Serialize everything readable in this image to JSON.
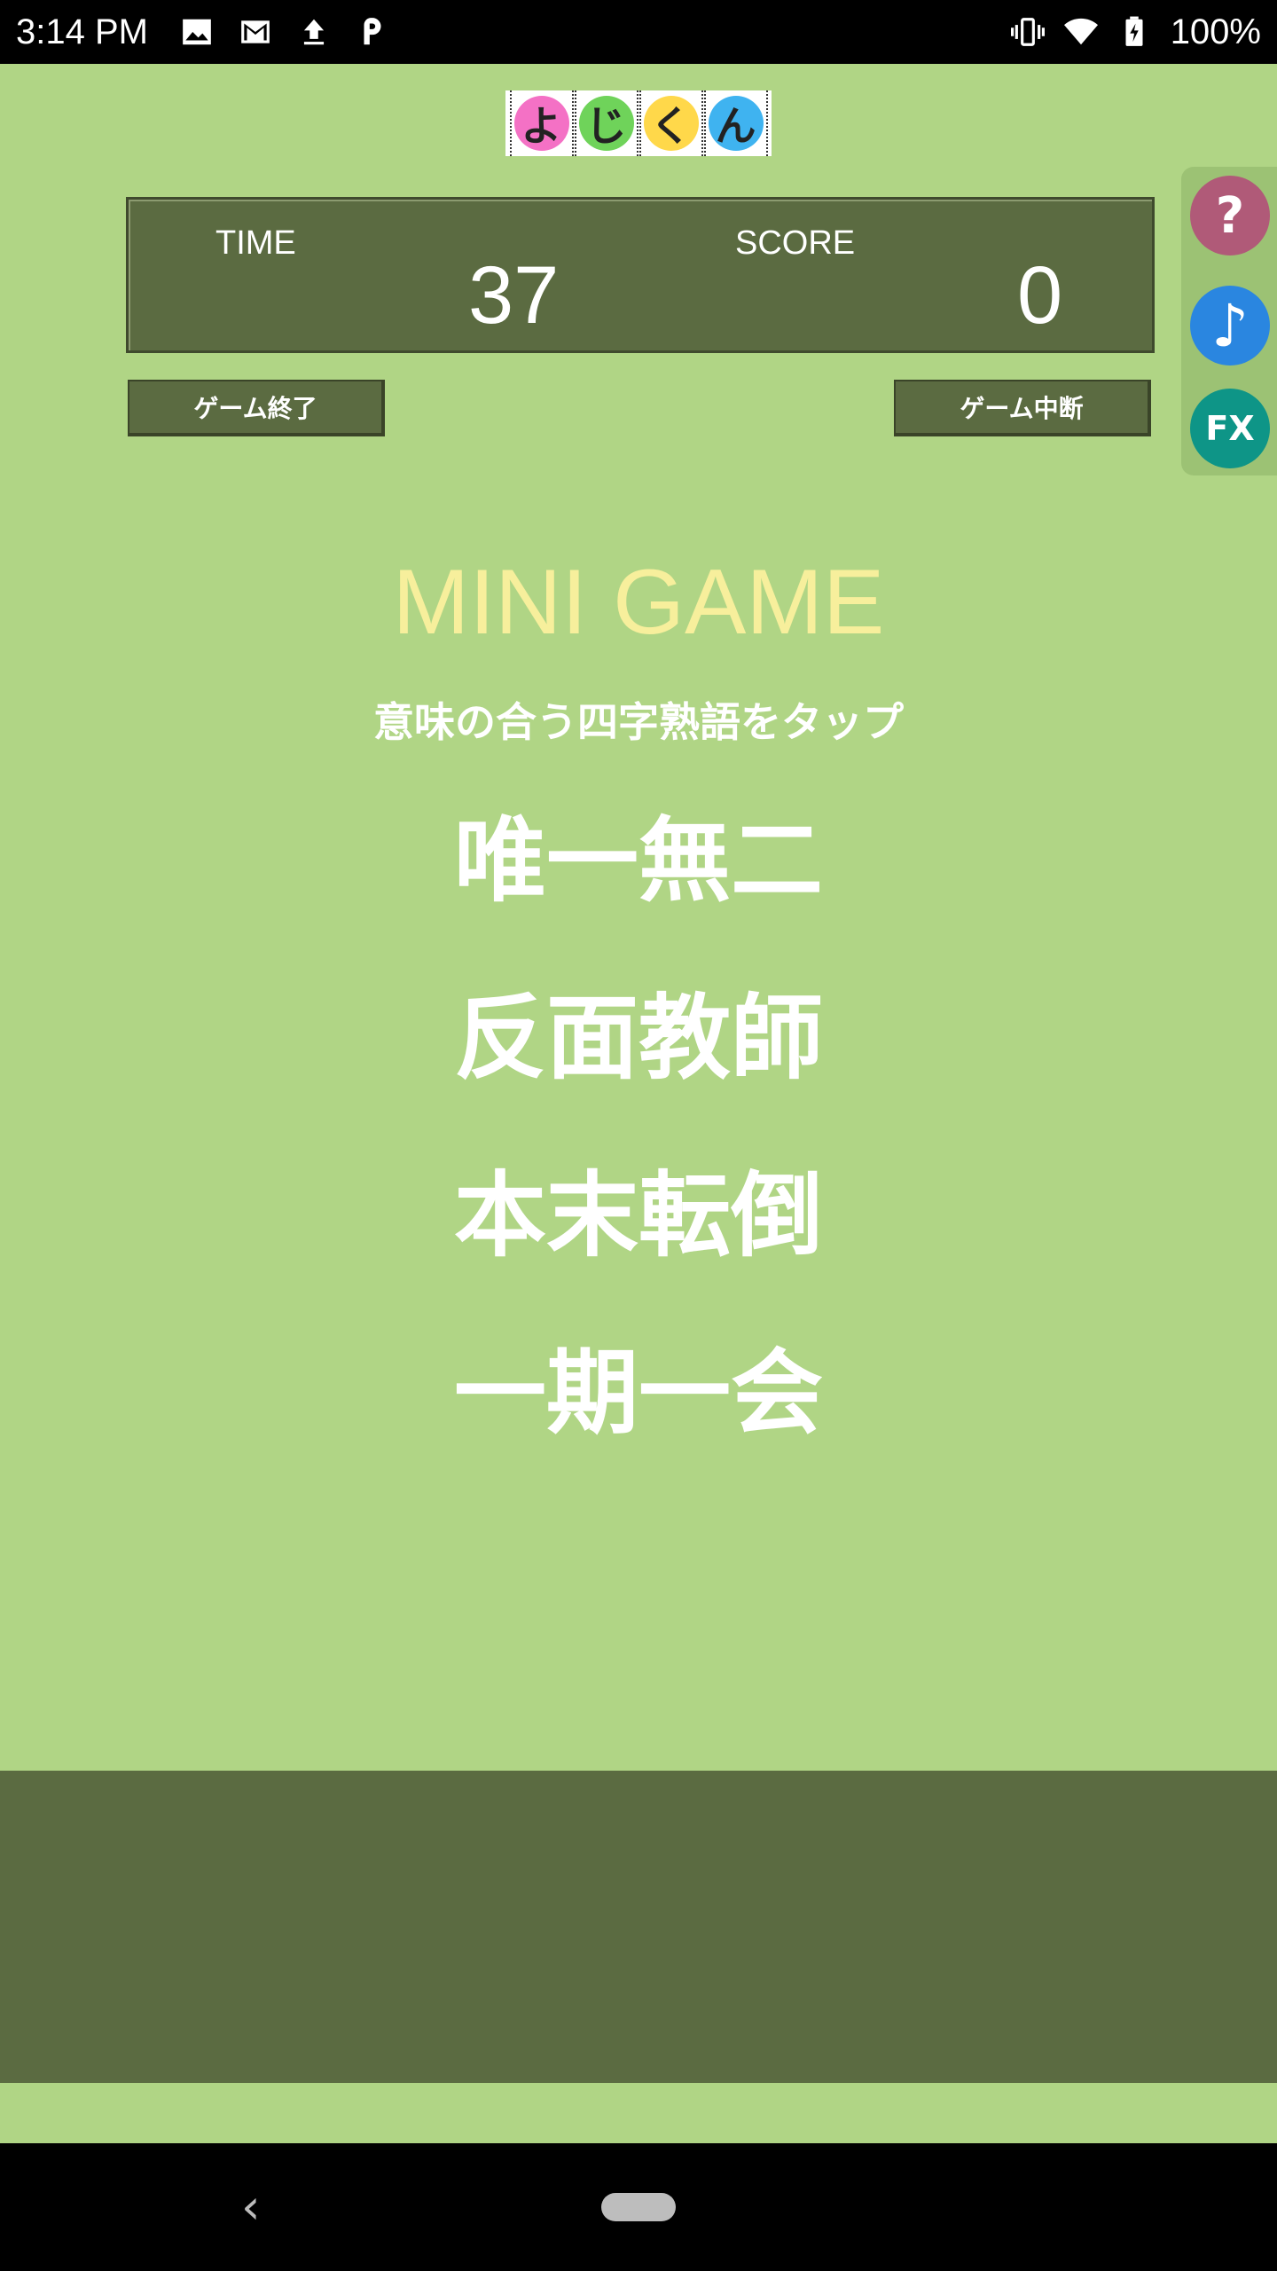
{
  "status_bar": {
    "time": "3:14 PM",
    "battery": "100%",
    "left_icons": [
      "image-icon",
      "mail-icon",
      "upload-icon",
      "p-icon"
    ],
    "right_icons": [
      "vibrate-icon",
      "wifi-icon",
      "battery-charging-icon"
    ]
  },
  "logo": {
    "chars": [
      "よ",
      "じ",
      "く",
      "ん"
    ],
    "colors": [
      "#f471c5",
      "#6fd35a",
      "#ffd84a",
      "#3fb3f0"
    ]
  },
  "score_panel": {
    "time_label": "TIME",
    "time_value": "37",
    "score_label": "SCORE",
    "score_value": "0"
  },
  "side_buttons": {
    "help_label": "?",
    "music_label": "♪",
    "fx_label": "FX",
    "help_color": "#b05a78",
    "music_color": "#2a86e0",
    "fx_color": "#0e9587"
  },
  "actions": {
    "end_label": "ゲーム終了",
    "pause_label": "ゲーム中断"
  },
  "game": {
    "title": "MINI GAME",
    "instruction": "意味の合う四字熟語をタップ",
    "choices": [
      "唯一無二",
      "反面教師",
      "本末転倒",
      "一期一会"
    ]
  },
  "nav": {
    "back_label": "‹"
  }
}
